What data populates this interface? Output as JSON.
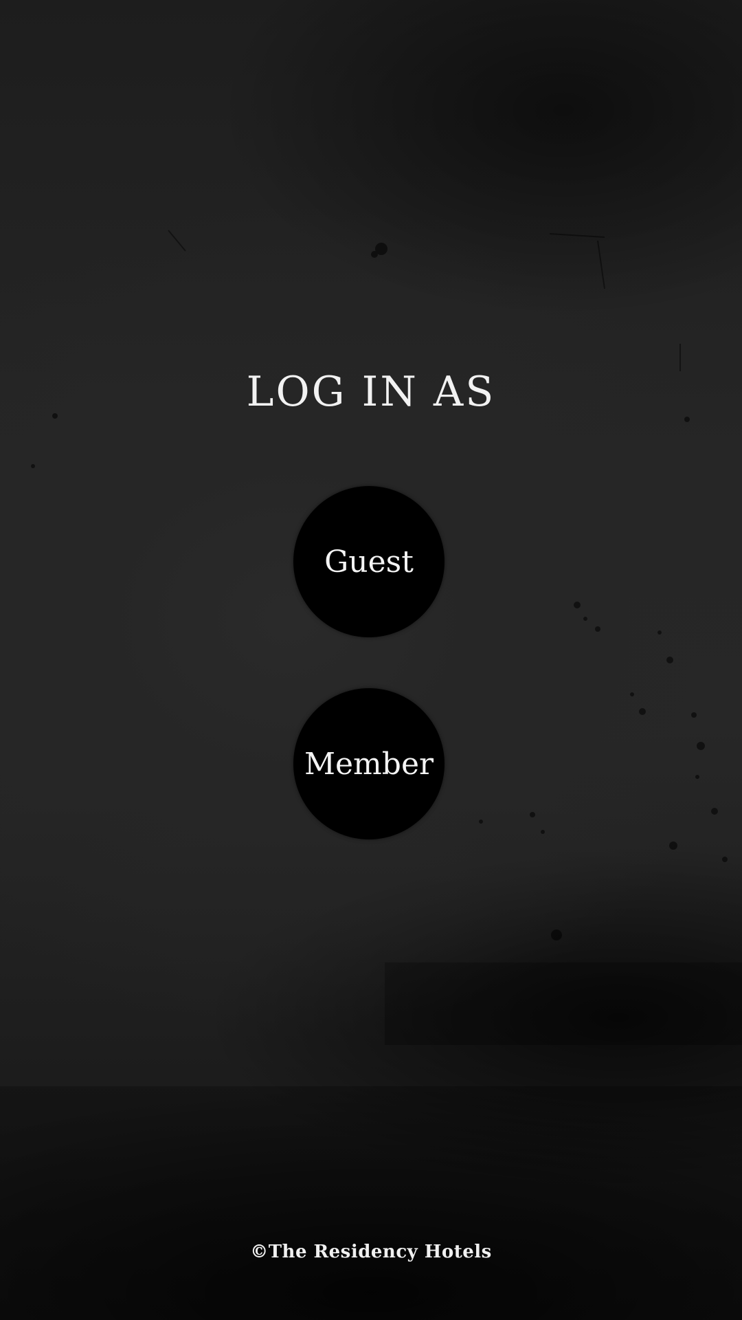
{
  "login": {
    "title": "LOG IN AS",
    "guest_label": "Guest",
    "member_label": "Member"
  },
  "footer": {
    "copyright": "©The Residency Hotels"
  },
  "colors": {
    "background": "#262626",
    "button": "#000000",
    "text": "#f2f2f2"
  }
}
